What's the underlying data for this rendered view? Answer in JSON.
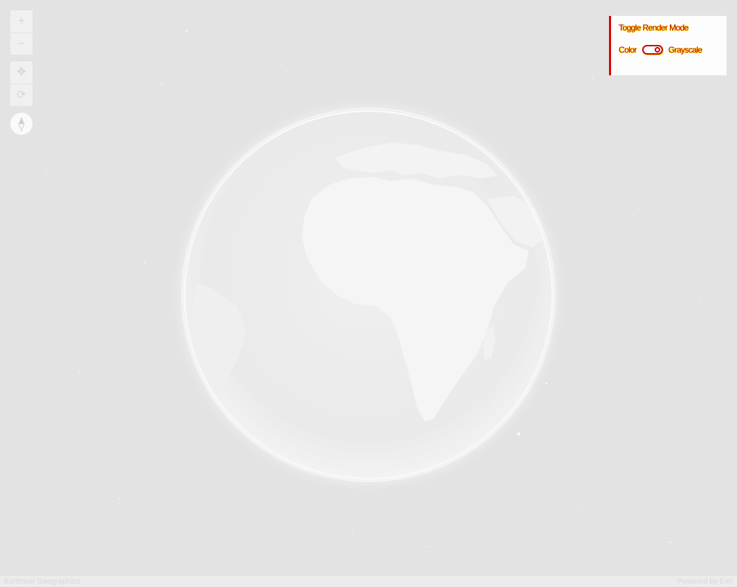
{
  "colors": {
    "space": "#e3e3e3",
    "globe": "#ececec",
    "land": "#f4f4f4",
    "panel_accent": "#e00000",
    "panel_text": "#c80000",
    "panel_text_halo": "#f4e200"
  },
  "nav": {
    "zoom_in_icon": "+",
    "zoom_out_icon": "−",
    "pan_icon": "✥",
    "rotate_icon": "⟳",
    "compass_icon": "compass-icon"
  },
  "toggle_panel": {
    "title": "Toggle Render Mode",
    "left_label": "Color",
    "right_label": "Grayscale",
    "state": "grayscale"
  },
  "attribution": {
    "left": "Earthstar Geographics",
    "right": "Powered by Esri"
  }
}
